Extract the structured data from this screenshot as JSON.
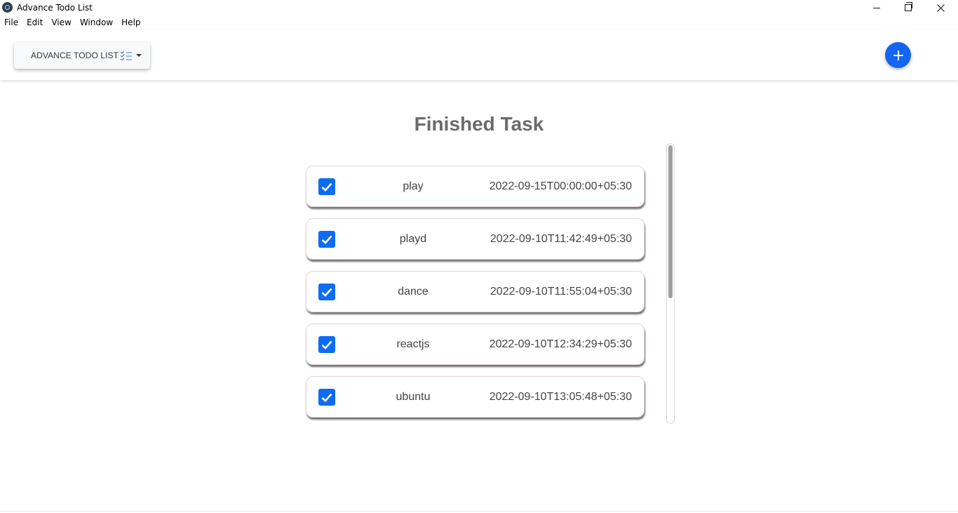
{
  "window": {
    "title": "Advance Todo List",
    "icon": "electron-atom-icon"
  },
  "menubar": {
    "items": [
      {
        "label": "File"
      },
      {
        "label": "Edit"
      },
      {
        "label": "View"
      },
      {
        "label": "Window"
      },
      {
        "label": "Help"
      }
    ]
  },
  "header": {
    "dropdown_label": "ADVANCE TODO LIST",
    "dropdown_icon": "checklist-icon",
    "add_icon": "plus-icon",
    "accent_color": "#1266f1"
  },
  "main": {
    "title": "Finished Task",
    "tasks": [
      {
        "name": "play",
        "date": "2022-09-15T00:00:00+05:30",
        "checked": true
      },
      {
        "name": "playd",
        "date": "2022-09-10T11:42:49+05:30",
        "checked": true
      },
      {
        "name": "dance",
        "date": "2022-09-10T11:55:04+05:30",
        "checked": true
      },
      {
        "name": "reactjs",
        "date": "2022-09-10T12:34:29+05:30",
        "checked": true
      },
      {
        "name": "ubuntu",
        "date": "2022-09-10T13:05:48+05:30",
        "checked": true
      }
    ],
    "checkbox_color": "#0b6cf5"
  }
}
